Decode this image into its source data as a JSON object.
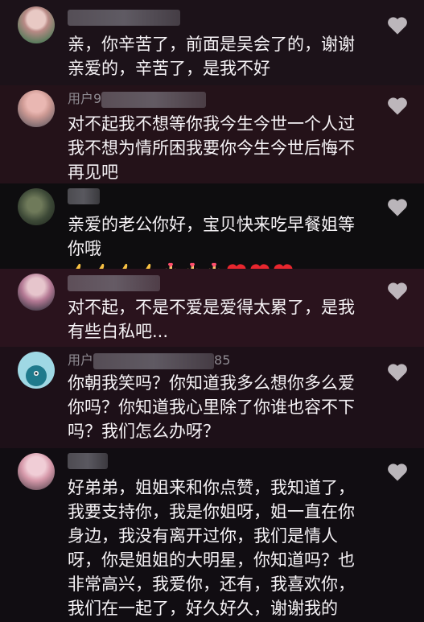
{
  "comments": [
    {
      "username": "",
      "lines": [
        "亲，你辛苦了，前面是吴会了的，谢谢",
        "亲爱的，辛苦了，是我不好"
      ]
    },
    {
      "username": "用户9",
      "lines": [
        "对不起我不想等你我今生今世一个人过",
        "我不想为情所困我要你今生今世后悔不",
        "再见吧"
      ]
    },
    {
      "username": "",
      "lines": [
        "亲爱的老公你好，宝贝快来吃早餐姐等",
        "你哦"
      ],
      "emojis": [
        "thumbs-up",
        "thumbs-up",
        "thumbs-up",
        "thumbs-up",
        "heart-hands",
        "heart-hands",
        "heart-hands",
        "red-heart",
        "red-heart",
        "red-heart"
      ]
    },
    {
      "username": "",
      "lines": [
        "对不起，不是不爱是爱得太累了，是我",
        "有些白私吧..."
      ]
    },
    {
      "username": "用户",
      "username_suffix": "85",
      "lines": [
        "你朝我笑吗？你知道我多么想你多么爱",
        "你吗？你知道我心里除了你谁也容不下",
        "吗？我们怎么办呀？"
      ]
    },
    {
      "username": "",
      "lines": [
        "好弟弟，姐姐来和你点赞，我知道了，",
        "我要支持你，我是你姐呀，姐一直在你",
        "身边，我没有离开过你，我们是情人",
        "呀，你是姐姐的大明星，你知道吗？也",
        "非常高兴，我爱你，还有，我喜欢你，",
        "我们在一起了，好久好久，谢谢我的"
      ]
    }
  ],
  "icons": {
    "like": "heart-outline-icon"
  },
  "colors": {
    "background": "#160e16",
    "username": "#8e8a91",
    "text": "#f6f3f6",
    "like": "#d8d4d8"
  }
}
